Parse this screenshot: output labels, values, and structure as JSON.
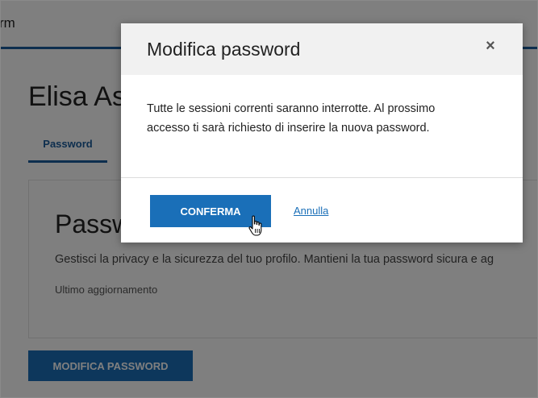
{
  "header": {
    "brand_fragment": "rm"
  },
  "profile": {
    "user_name": "Elisa As"
  },
  "tabs": [
    {
      "label": "Password"
    }
  ],
  "card": {
    "title": "Passw",
    "description": "Gestisci la privacy e la sicurezza del tuo profilo. Mantieni la tua password sicura e ag",
    "last_update_label": "Ultimo aggiornamento"
  },
  "page_button": {
    "label": "MODIFICA PASSWORD"
  },
  "modal": {
    "title": "Modifica password",
    "close_symbol": "×",
    "body_line_1": "Tutte le sessioni correnti saranno interrotte. Al prossimo",
    "body_line_2": "accesso ti sarà richiesto di inserire la nuova password.",
    "confirm_label": "CONFERMA",
    "cancel_label": "Annulla"
  },
  "colors": {
    "accent": "#1a6fb8",
    "header_bg": "#f1f1f1",
    "overlay": "rgba(0,0,0,0.5)"
  },
  "icons": {
    "close": "close-icon",
    "cursor": "hand-pointer-cursor-icon"
  }
}
